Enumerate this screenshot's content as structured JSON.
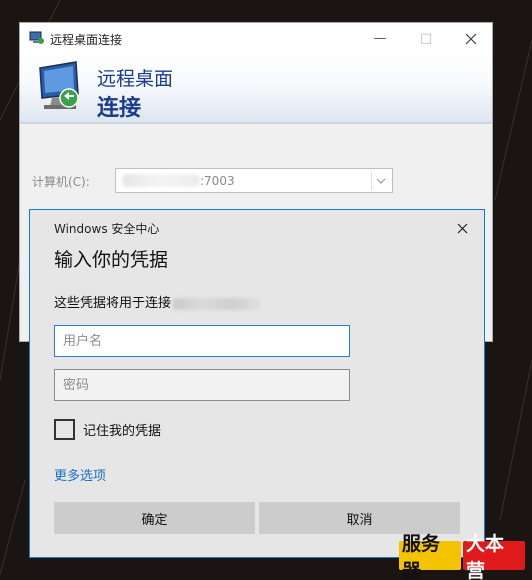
{
  "rdc_window": {
    "title": "远程桌面连接",
    "heading_line1": "远程桌面",
    "heading_line2": "连接",
    "computer_label": "计算机(C):",
    "computer_value_visible": ":7003"
  },
  "security_dialog": {
    "title": "Windows 安全中心",
    "heading": "输入你的凭据",
    "description": "这些凭据将用于连接",
    "username_placeholder": "用户名",
    "password_placeholder": "密码",
    "remember_label": "记住我的凭据",
    "more_options": "更多选项",
    "ok_button": "确定",
    "cancel_button": "取消"
  },
  "watermark": {
    "part1": "服务器",
    "part2": "大本营"
  },
  "colors": {
    "accent": "#1979ca",
    "heading_blue": "#1a3c8c",
    "link_blue": "#1f6fc4",
    "watermark_yellow": "#f5c400",
    "watermark_red": "#e01a1a"
  }
}
